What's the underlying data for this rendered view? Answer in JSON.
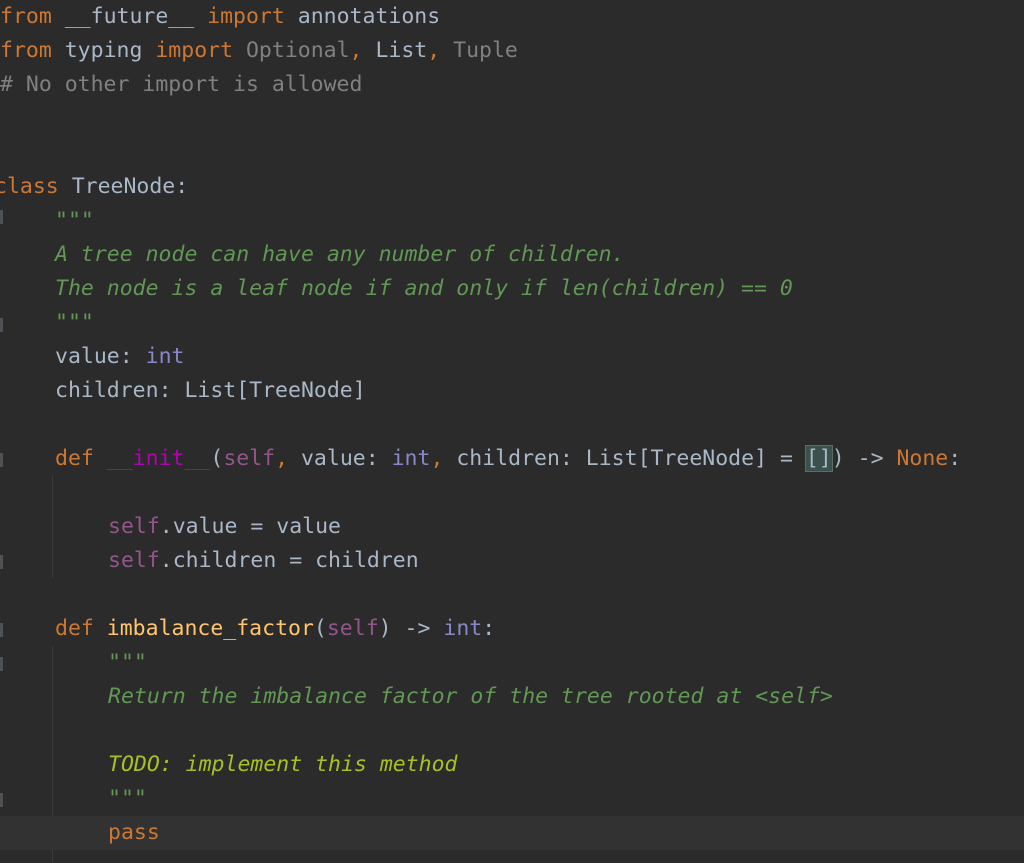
{
  "editor": {
    "lines": {
      "l1": {
        "kw_from": "from",
        "module": "__future__",
        "kw_import": "import",
        "name": "annotations"
      },
      "l2": {
        "kw_from": "from",
        "module": "typing",
        "kw_import": "import",
        "opt": "Optional",
        "comma1": ",",
        "list": "List",
        "comma2": ",",
        "tuple": "Tuple"
      },
      "l3": {
        "comment": "# No other import is allowed"
      },
      "l6": {
        "kw_class": "class",
        "name": "TreeNode",
        "colon": ":"
      },
      "l7": {
        "quotes": "\"\"\""
      },
      "l8": {
        "text": "A tree node can have any number of children."
      },
      "l9": {
        "text": "The node is a leaf node if and only if len(children) == 0"
      },
      "l10": {
        "quotes": "\"\"\""
      },
      "l11": {
        "attr": "value",
        "sep": ": ",
        "type": "int"
      },
      "l12": {
        "attr": "children",
        "sep": ": ",
        "type": "List[TreeNode]"
      },
      "l14": {
        "kw_def": "def",
        "name": "__init__",
        "paren_open": "(",
        "self": "self",
        "c1": ",",
        "p_value": " value: ",
        "t_int": "int",
        "c2": ",",
        "p_children": " children: List[TreeNode] = ",
        "default": "[]",
        "tail": ") -> ",
        "none": "None",
        "colon": ":"
      },
      "l16": {
        "self": "self",
        "rest": ".value = value"
      },
      "l17": {
        "self": "self",
        "rest": ".children = children"
      },
      "l19": {
        "kw_def": "def",
        "name": "imbalance_factor",
        "paren_open": "(",
        "self": "self",
        "tail": ") -> ",
        "ret": "int",
        "colon": ":"
      },
      "l20": {
        "quotes": "\"\"\""
      },
      "l21": {
        "text": "Return the imbalance factor of the tree rooted at <self>"
      },
      "l23": {
        "text": "TODO: implement this method"
      },
      "l24": {
        "quotes": "\"\"\""
      },
      "l25": {
        "kw_pass": "pass"
      }
    }
  }
}
